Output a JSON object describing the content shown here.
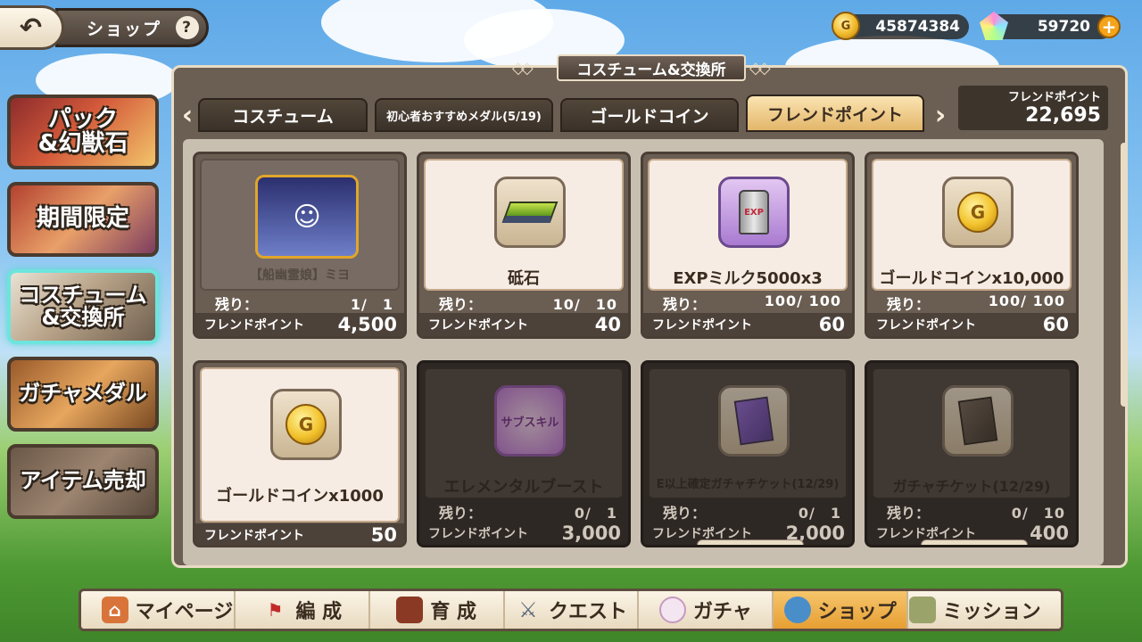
{
  "header": {
    "title": "ショップ",
    "help_symbol": "?",
    "back_symbol": "↶"
  },
  "currency": {
    "gold": "45874384",
    "gems": "59720",
    "gold_symbol": "G",
    "plus_symbol": "+"
  },
  "sidebar": {
    "items": [
      {
        "label": "パック\n&幻獣石"
      },
      {
        "label": "期間限定"
      },
      {
        "label": "コスチューム\n&交換所"
      },
      {
        "label": "ガチャメダル"
      },
      {
        "label": "アイテム売却"
      }
    ]
  },
  "panel": {
    "title": "コスチューム&交換所",
    "tabs": [
      {
        "label": "コスチューム"
      },
      {
        "label": "初心者おすすめメダル(5/19)"
      },
      {
        "label": "ゴールドコイン"
      },
      {
        "label": "フレンドポイント"
      }
    ],
    "arrow_left": "‹",
    "arrow_right": "›",
    "points_label": "フレンドポイント",
    "points_value": "22,695"
  },
  "common": {
    "stock_label": "残り：",
    "price_label": "フレンドポイント"
  },
  "items": [
    {
      "name": "【船幽霊娘】ミヨ",
      "stock": "1/　1",
      "price": "4,500",
      "icon": "character-portrait-icon"
    },
    {
      "name": "砥石",
      "stock": "10/　10",
      "price": "40",
      "icon": "whetstone-icon"
    },
    {
      "name": "EXPミルク5000x3",
      "stock": "100/ 100",
      "price": "60",
      "icon": "exp-milk-can-icon"
    },
    {
      "name": "ゴールドコインx10,000",
      "stock": "100/ 100",
      "price": "60",
      "icon": "gold-coin-icon"
    },
    {
      "name": "ゴールドコインx1000",
      "stock": "",
      "price": "50",
      "icon": "gold-coin-icon"
    },
    {
      "name": "エレメンタルブースト",
      "stock": "0/　1",
      "price": "3,000",
      "icon": "sub-skill-icon",
      "icon_text": "サブスキル"
    },
    {
      "name": "E以上確定ガチャチケット(12/29)",
      "stock": "0/　1",
      "price": "2,000",
      "icon": "gacha-ticket-purple-icon"
    },
    {
      "name": "ガチャチケット(12/29)",
      "stock": "0/　10",
      "price": "400",
      "icon": "gacha-ticket-brown-icon"
    }
  ],
  "bottom_nav": [
    {
      "label": "マイページ",
      "icon": "mushroom-house-icon"
    },
    {
      "label": "編 成",
      "icon": "flag-icon"
    },
    {
      "label": "育 成",
      "icon": "book-icon"
    },
    {
      "label": "クエスト",
      "icon": "crossed-swords-icon"
    },
    {
      "label": "ガチャ",
      "icon": "egg-icon"
    },
    {
      "label": "ショップ",
      "icon": "bag-icon"
    },
    {
      "label": "ミッション",
      "icon": "scroll-icon"
    }
  ]
}
